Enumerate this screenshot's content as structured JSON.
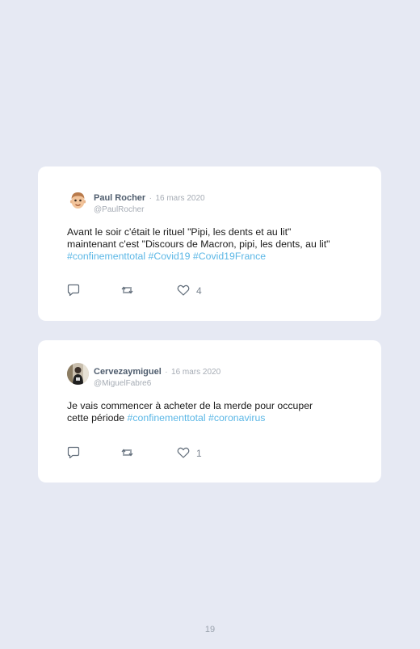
{
  "tweets": [
    {
      "name": "Paul Rocher",
      "separator": "·",
      "date": "16 mars 2020",
      "handle": "@PaulRocher",
      "line1": "Avant le soir c'était le rituel \"Pipi, les dents et au lit\"",
      "line2": "maintenant c'est \"Discours de Macron, pipi, les dents, au lit\"",
      "tags": [
        "#confinementtotal",
        "#Covid19",
        "#Covid19France"
      ],
      "likes": "4",
      "icons": {
        "reply": "reply-icon",
        "retweet": "retweet-icon",
        "like": "heart-icon"
      }
    },
    {
      "name": "Cervezaymiguel",
      "separator": "·",
      "date": "16 mars 2020",
      "handle": "@MiguelFabre6",
      "line1": "Je vais commencer à acheter de la merde pour occuper",
      "line2_text": "cette période",
      "tags": [
        "#confinementtotal",
        "#coronavirus"
      ],
      "likes": "1",
      "icons": {
        "reply": "reply-icon",
        "retweet": "retweet-icon",
        "like": "heart-icon"
      }
    }
  ],
  "page_number": "19",
  "colors": {
    "background": "#e6e9f3",
    "card": "#ffffff",
    "hashtag": "#5bb7e6",
    "name": "#4f5d6e",
    "muted": "#a6acb5"
  }
}
